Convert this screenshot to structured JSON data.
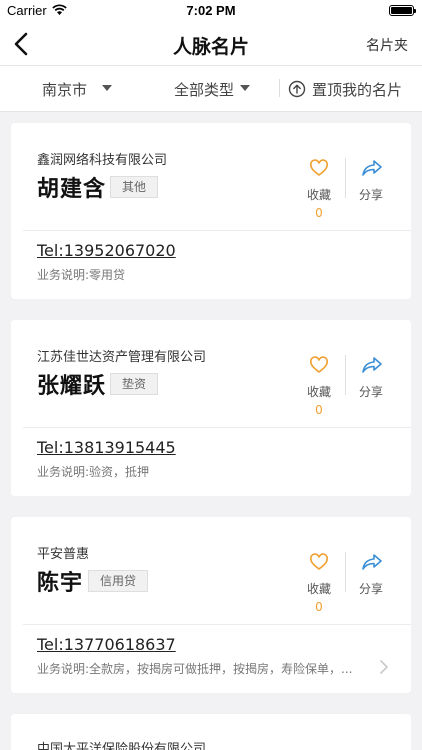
{
  "status": {
    "carrier": "Carrier",
    "time": "7:02 PM"
  },
  "nav": {
    "title": "人脉名片",
    "right_label": "名片夹"
  },
  "filters": {
    "city": "南京市",
    "type": "全部类型",
    "pin_label": "置顶我的名片"
  },
  "cards": [
    {
      "company": "鑫润网络科技有限公司",
      "name": "胡建含",
      "tag": "其他",
      "fav_label": "收藏",
      "fav_count": "0",
      "share_label": "分享",
      "tel": "Tel:13952067020",
      "desc": "业务说明:零用贷"
    },
    {
      "company": "江苏佳世达资产管理有限公司",
      "name": "张耀跃",
      "tag": "垫资",
      "fav_label": "收藏",
      "fav_count": "0",
      "share_label": "分享",
      "tel": "Tel:13813915445",
      "desc": "业务说明:验资，抵押"
    },
    {
      "company": "平安普惠",
      "name": "陈宇",
      "tag": "信用贷",
      "fav_label": "收藏",
      "fav_count": "0",
      "share_label": "分享",
      "tel": "Tel:13770618637",
      "desc": "业务说明:全款房，按揭房可做抵押，按揭房，寿险保单，..."
    },
    {
      "company": "中国太平洋保险股份有限公司"
    }
  ],
  "colors": {
    "accent_orange": "#f0a030",
    "share_blue": "#3a8fd6"
  },
  "icons": {
    "back": "chevron-left-icon",
    "dropdown": "triangle-down-icon",
    "pin": "arrow-up-circle-icon",
    "fav": "heart-icon",
    "share": "share-arrow-icon",
    "more": "chevron-right-icon"
  }
}
